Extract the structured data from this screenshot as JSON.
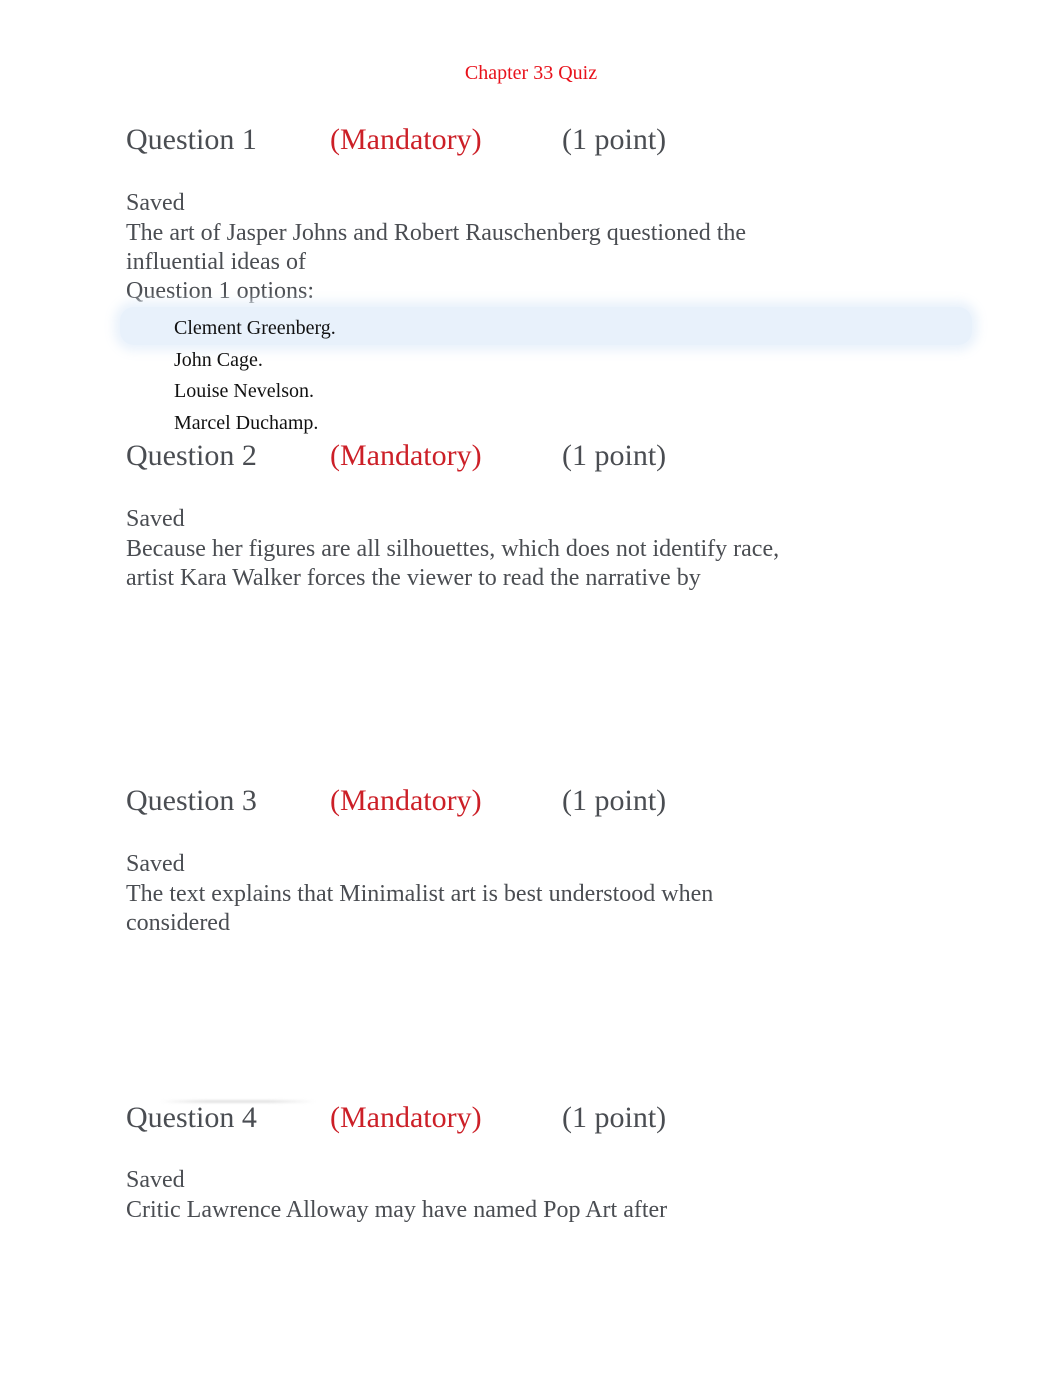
{
  "document": {
    "title": "Chapter 33 Quiz",
    "colors": {
      "title": "#e8111b",
      "mandatory": "#cc1f27",
      "question_text": "#4a4d52",
      "option_text": "#111111",
      "selected_option_highlight": "#e8f1fb"
    }
  },
  "questions": [
    {
      "number_label": "Question 1",
      "mandatory_label": "(Mandatory)",
      "points_label": "(1 point)",
      "status": "Saved",
      "stem": "The art of Jasper Johns and Robert Rauschenberg questioned the influential ideas of",
      "options_label": "Question 1 options:",
      "options": [
        {
          "label": "Clement Greenberg.",
          "highlighted": true
        },
        {
          "label": "John Cage.",
          "highlighted": false
        },
        {
          "label": "Louise Nevelson.",
          "highlighted": false
        },
        {
          "label": "Marcel Duchamp.",
          "highlighted": false
        }
      ]
    },
    {
      "number_label": "Question 2",
      "mandatory_label": "(Mandatory)",
      "points_label": "(1 point)",
      "status": "Saved",
      "stem": "Because her figures are all silhouettes, which does not identify race, artist Kara Walker forces the viewer to read the narrative by"
    },
    {
      "number_label": "Question 3",
      "mandatory_label": "(Mandatory)",
      "points_label": "(1 point)",
      "status": "Saved",
      "stem": "The text explains that Minimalist art is best understood when considered"
    },
    {
      "number_label": "Question 4",
      "mandatory_label": "(Mandatory)",
      "points_label": "(1 point)",
      "status": "Saved",
      "stem": "Critic Lawrence Alloway may have named Pop Art after"
    }
  ]
}
